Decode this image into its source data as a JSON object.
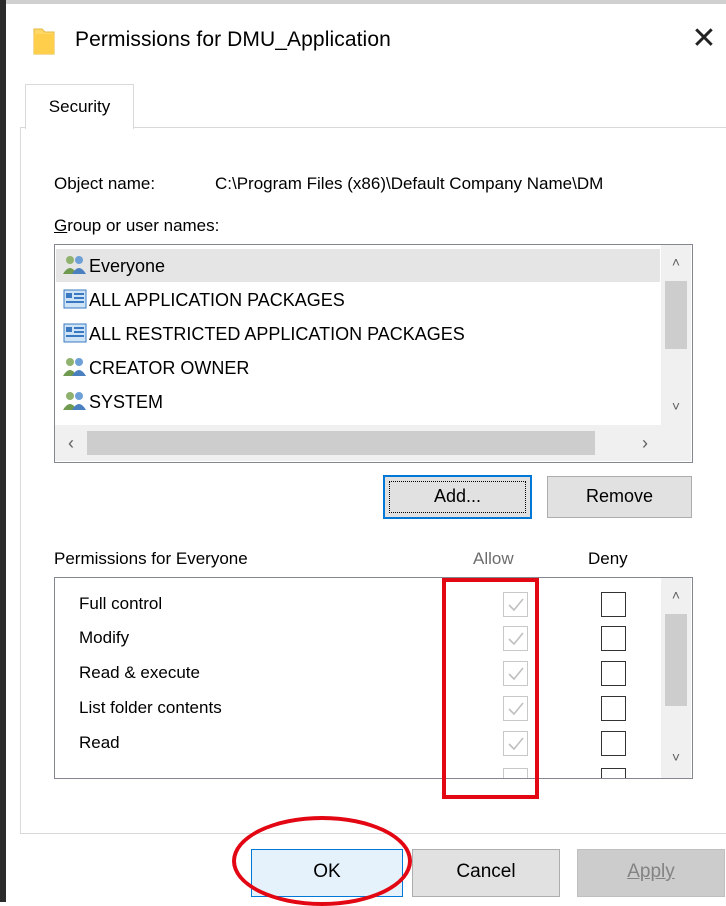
{
  "window": {
    "title": "Permissions for DMU_Application",
    "close_symbol": "✕"
  },
  "tabs": [
    {
      "label": "Security",
      "active": true
    }
  ],
  "object": {
    "label": "Object name:",
    "value": "C:\\Program Files (x86)\\Default Company Name\\DM"
  },
  "groups": {
    "label_prefix": "G",
    "label_rest": "roup or user names:",
    "items": [
      {
        "name": "Everyone",
        "icon": "users-icon",
        "selected": true
      },
      {
        "name": "ALL APPLICATION PACKAGES",
        "icon": "app-packages-icon",
        "selected": false
      },
      {
        "name": "ALL RESTRICTED APPLICATION PACKAGES",
        "icon": "app-packages-icon",
        "selected": false
      },
      {
        "name": "CREATOR OWNER",
        "icon": "users-icon",
        "selected": false
      },
      {
        "name": "SYSTEM",
        "icon": "users-icon",
        "selected": false
      }
    ]
  },
  "buttons": {
    "add": "Add...",
    "remove": "Remove",
    "ok": "OK",
    "cancel": "Cancel",
    "apply": "Apply"
  },
  "permissions": {
    "label": "Permissions for Everyone",
    "allow_header": "Allow",
    "deny_header": "Deny",
    "items": [
      {
        "name": "Full control",
        "allow": true,
        "deny": false
      },
      {
        "name": "Modify",
        "allow": true,
        "deny": false
      },
      {
        "name": "Read & execute",
        "allow": true,
        "deny": false
      },
      {
        "name": "List folder contents",
        "allow": true,
        "deny": false
      },
      {
        "name": "Read",
        "allow": true,
        "deny": false
      }
    ]
  },
  "colors": {
    "highlight_red": "#e30613",
    "focus_blue": "#0078d7",
    "selection_gray": "#e5e5e5"
  }
}
